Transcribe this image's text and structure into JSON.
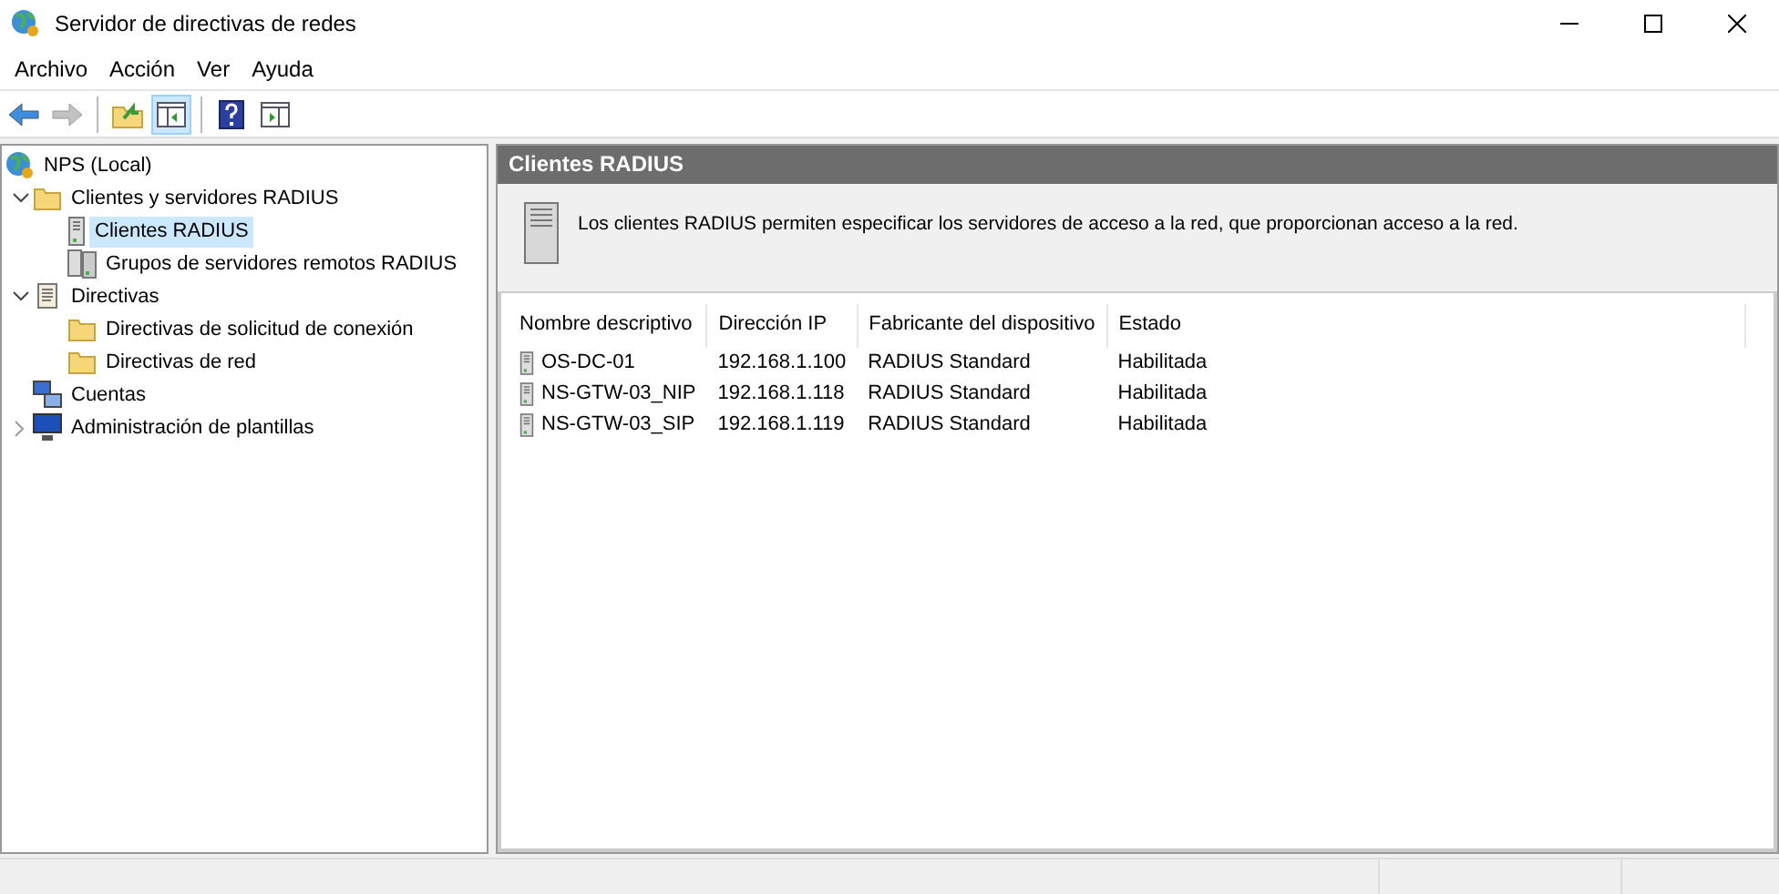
{
  "window": {
    "title": "Servidor de directivas de redes"
  },
  "menu": [
    "Archivo",
    "Acción",
    "Ver",
    "Ayuda"
  ],
  "toolbar": [
    {
      "kind": "back",
      "disabled": false,
      "pressed": false
    },
    {
      "kind": "forward",
      "disabled": true,
      "pressed": false
    },
    {
      "kind": "separator"
    },
    {
      "kind": "up",
      "disabled": false,
      "pressed": false
    },
    {
      "kind": "tree",
      "disabled": false,
      "pressed": true
    },
    {
      "kind": "separator"
    },
    {
      "kind": "help",
      "disabled": false,
      "pressed": false
    },
    {
      "kind": "pane",
      "disabled": false,
      "pressed": false
    }
  ],
  "tree": [
    {
      "label": "NPS (Local)",
      "kind": "globe",
      "selected": false,
      "children": [
        {
          "label": "Clientes y servidores RADIUS",
          "kind": "folder",
          "expanded": true,
          "selected": false,
          "children": [
            {
              "label": "Clientes RADIUS",
              "kind": "server",
              "selected": true
            },
            {
              "label": "Grupos de servidores remotos RADIUS",
              "kind": "servers",
              "selected": false
            }
          ]
        },
        {
          "label": "Directivas",
          "kind": "scroll",
          "expanded": true,
          "selected": false,
          "children": [
            {
              "label": "Directivas de solicitud de conexión",
              "kind": "folder",
              "selected": false
            },
            {
              "label": "Directivas de red",
              "kind": "folder",
              "selected": false
            }
          ]
        },
        {
          "label": "Cuentas",
          "kind": "computers",
          "selected": false
        },
        {
          "label": "Administración de plantillas",
          "kind": "monitor",
          "expanded": false,
          "selected": false
        }
      ]
    }
  ],
  "pane": {
    "title": "Clientes RADIUS",
    "description": "Los clientes RADIUS permiten especificar los servidores de acceso a la red, que proporcionan acceso a la red."
  },
  "table": {
    "columns": [
      "Nombre descriptivo",
      "Dirección IP",
      "Fabricante del dispositivo",
      "Estado"
    ],
    "rows": [
      [
        "OS-DC-01",
        "192.168.1.100",
        "RADIUS Standard",
        "Habilitada"
      ],
      [
        "NS-GTW-03_NIP",
        "192.168.1.118",
        "RADIUS Standard",
        "Habilitada"
      ],
      [
        "NS-GTW-03_SIP",
        "192.168.1.119",
        "RADIUS Standard",
        "Habilitada"
      ]
    ]
  }
}
